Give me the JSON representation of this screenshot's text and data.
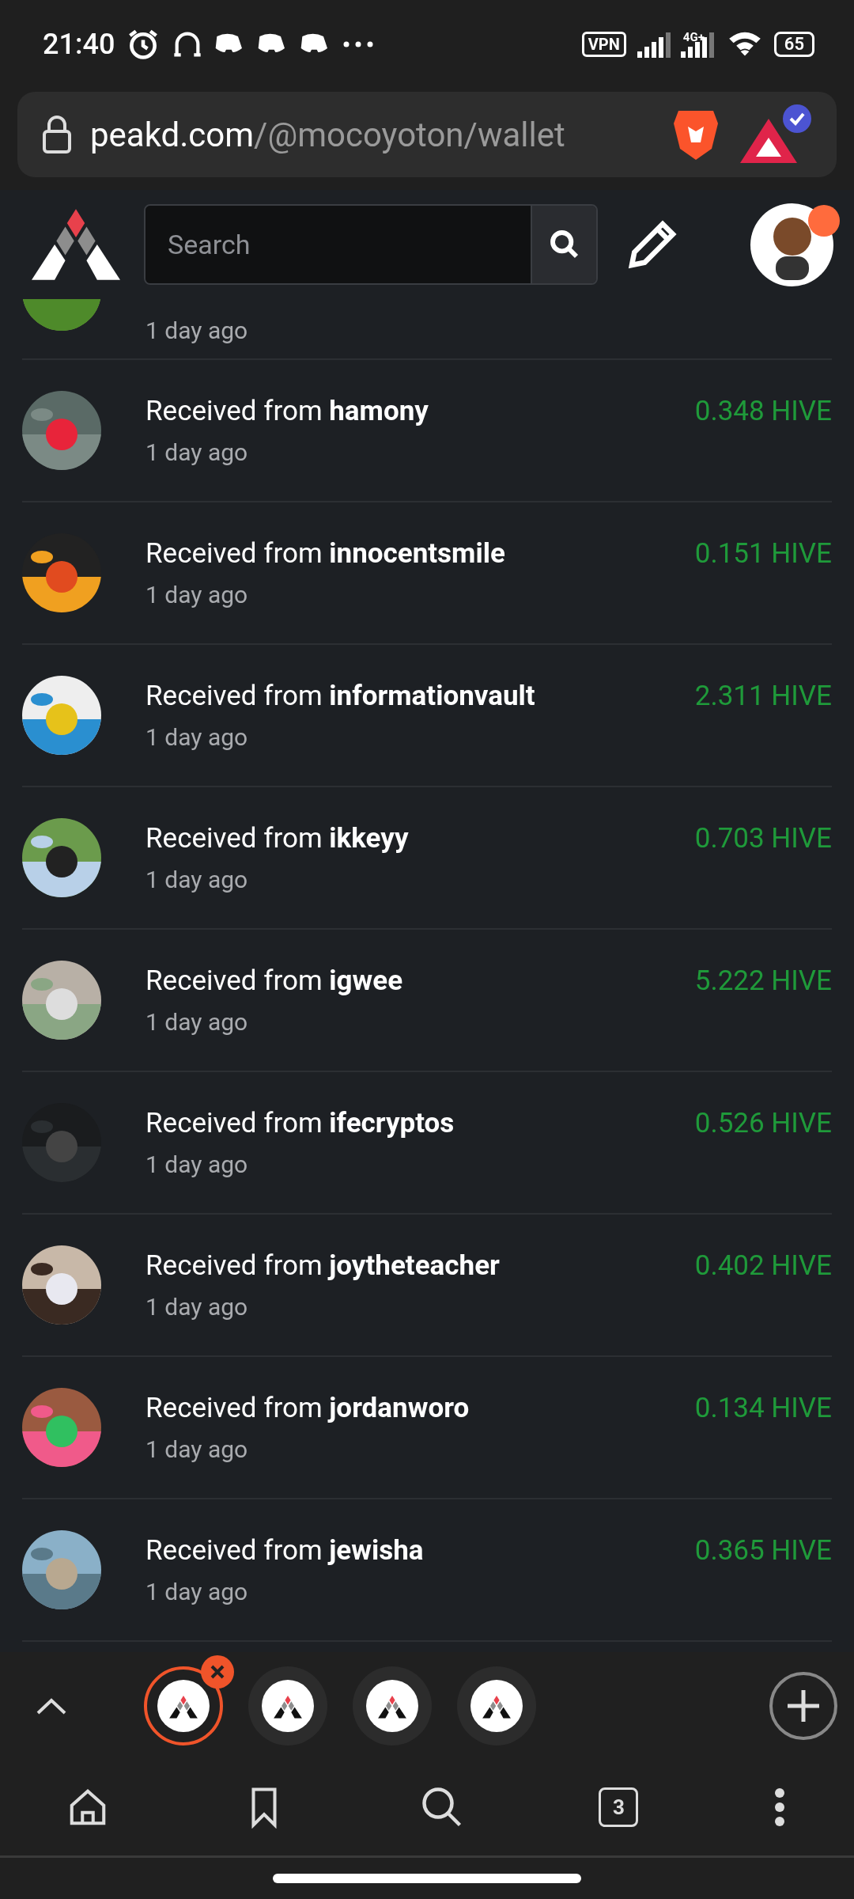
{
  "status_bar": {
    "time": "21:40",
    "vpn": "VPN",
    "network": "4G+",
    "battery": "65"
  },
  "address_bar": {
    "domain": "peakd.com",
    "path": "/@mocoyoton/wallet"
  },
  "header": {
    "search": {
      "placeholder": "Search"
    },
    "notification_dot": true
  },
  "partial_row": {
    "time": "1 day ago"
  },
  "transactions": [
    {
      "prefix": "Received from",
      "user": "hamony",
      "time": "1 day ago",
      "amount": "0.348 HIVE"
    },
    {
      "prefix": "Received from",
      "user": "innocentsmile",
      "time": "1 day ago",
      "amount": "0.151 HIVE"
    },
    {
      "prefix": "Received from",
      "user": "informationvault",
      "time": "1 day ago",
      "amount": "2.311 HIVE"
    },
    {
      "prefix": "Received from",
      "user": "ikkeyy",
      "time": "1 day ago",
      "amount": "0.703 HIVE"
    },
    {
      "prefix": "Received from",
      "user": "igwee",
      "time": "1 day ago",
      "amount": "5.222 HIVE"
    },
    {
      "prefix": "Received from",
      "user": "ifecryptos",
      "time": "1 day ago",
      "amount": "0.526 HIVE"
    },
    {
      "prefix": "Received from",
      "user": "joytheteacher",
      "time": "1 day ago",
      "amount": "0.402 HIVE"
    },
    {
      "prefix": "Received from",
      "user": "jordanworo",
      "time": "1 day ago",
      "amount": "0.134 HIVE"
    },
    {
      "prefix": "Received from",
      "user": "jewisha",
      "time": "1 day ago",
      "amount": "0.365 HIVE"
    }
  ],
  "tab_strip": {
    "tabs": [
      {
        "selected": true
      },
      {
        "selected": false
      },
      {
        "selected": false
      },
      {
        "selected": false
      }
    ]
  },
  "bottom_nav": {
    "tab_count": "3"
  }
}
